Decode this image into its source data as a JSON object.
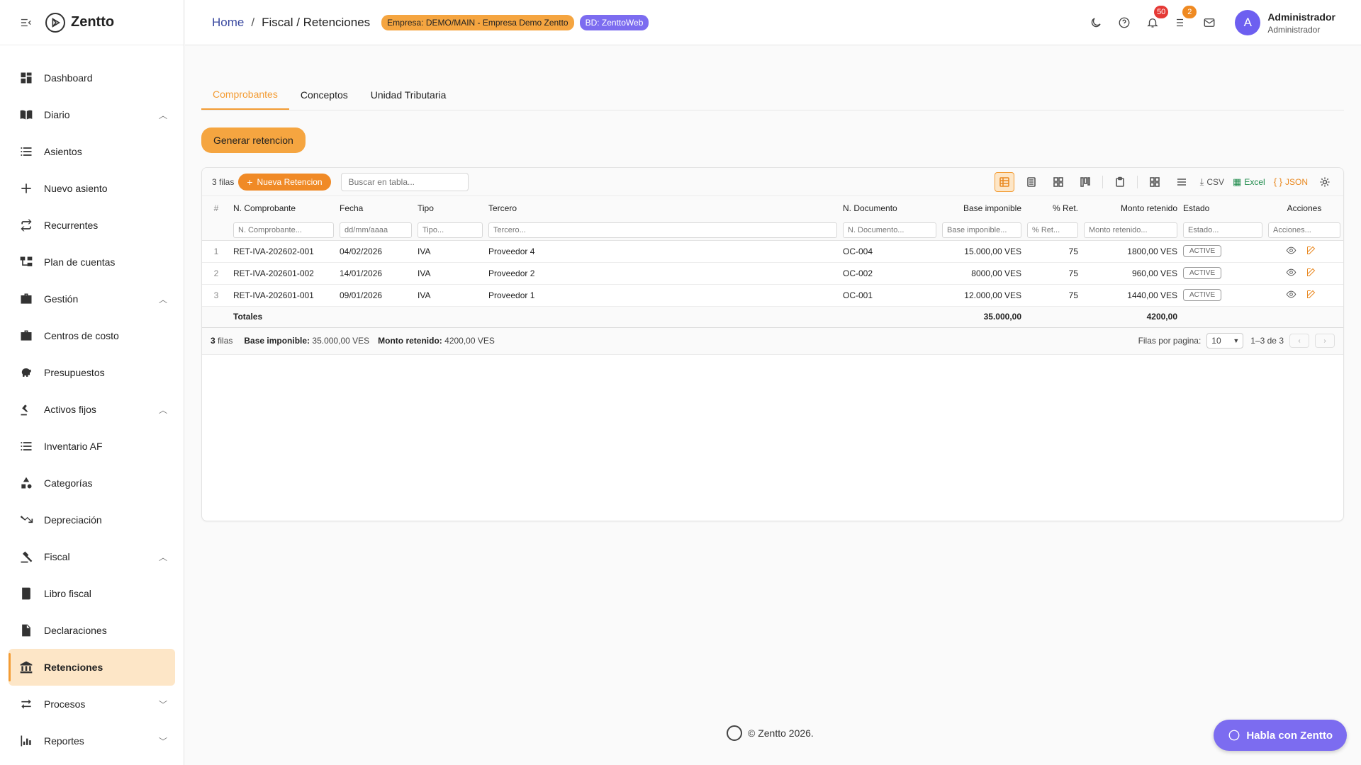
{
  "app": {
    "brand": "Zentto"
  },
  "header": {
    "crumb_home": "Home",
    "crumb_sep": "/",
    "crumb_current": "Fiscal / Retenciones",
    "badge_empresa": "Empresa: DEMO/MAIN - Empresa Demo Zentto",
    "badge_db": "BD: ZenttoWeb",
    "notif_count": "50",
    "tasks_count": "2",
    "user_initial": "A",
    "user_name": "Administrador",
    "user_role": "Administrador"
  },
  "sidebar": {
    "items": [
      {
        "label": "Dashboard",
        "icon": "dashboard-icon",
        "chevron": ""
      },
      {
        "label": "Diario",
        "icon": "book-icon",
        "chevron": "up"
      },
      {
        "label": "Asientos",
        "icon": "list-icon",
        "chevron": ""
      },
      {
        "label": "Nuevo asiento",
        "icon": "plus-icon",
        "chevron": ""
      },
      {
        "label": "Recurrentes",
        "icon": "repeat-icon",
        "chevron": ""
      },
      {
        "label": "Plan de cuentas",
        "icon": "account-tree-icon",
        "chevron": ""
      },
      {
        "label": "Gestión",
        "icon": "briefcase-icon",
        "chevron": "up"
      },
      {
        "label": "Centros de costo",
        "icon": "briefcase-icon",
        "chevron": ""
      },
      {
        "label": "Presupuestos",
        "icon": "piggy-bank-icon",
        "chevron": ""
      },
      {
        "label": "Activos fijos",
        "icon": "precision-icon",
        "chevron": "up"
      },
      {
        "label": "Inventario AF",
        "icon": "list-icon",
        "chevron": ""
      },
      {
        "label": "Categorías",
        "icon": "category-icon",
        "chevron": ""
      },
      {
        "label": "Depreciación",
        "icon": "trending-down-icon",
        "chevron": ""
      },
      {
        "label": "Fiscal",
        "icon": "gavel-icon",
        "chevron": "up"
      },
      {
        "label": "Libro fiscal",
        "icon": "ledger-icon",
        "chevron": ""
      },
      {
        "label": "Declaraciones",
        "icon": "document-icon",
        "chevron": ""
      },
      {
        "label": "Retenciones",
        "icon": "bank-icon",
        "chevron": "",
        "active": true
      },
      {
        "label": "Procesos",
        "icon": "swap-icon",
        "chevron": "down"
      },
      {
        "label": "Reportes",
        "icon": "chart-icon",
        "chevron": "down"
      }
    ]
  },
  "tabs": [
    "Comprobantes",
    "Conceptos",
    "Unidad Tributaria"
  ],
  "generate_button": "Generar retencion",
  "grid": {
    "row_count_label": "3 filas",
    "new_button": "Nueva Retencion",
    "search_placeholder": "Buscar en tabla...",
    "csv_label": "CSV",
    "excel_label": "Excel",
    "json_label": "JSON",
    "columns": [
      "#",
      "N. Comprobante",
      "Fecha",
      "Tipo",
      "Tercero",
      "N. Documento",
      "Base imponible",
      "% Ret.",
      "Monto retenido",
      "Estado",
      "Acciones"
    ],
    "filters": [
      "N. Comprobante...",
      "dd/mm/aaaa",
      "Tipo...",
      "Tercero...",
      "N. Documento...",
      "Base imponible...",
      "% Ret...",
      "Monto retenido...",
      "Estado...",
      "Acciones..."
    ],
    "rows": [
      {
        "idx": "1",
        "comprobante": "RET-IVA-202602-001",
        "fecha": "04/02/2026",
        "tipo": "IVA",
        "tercero": "Proveedor 4",
        "documento": "OC-004",
        "base": "15.000,00 VES",
        "ret": "75",
        "monto": "1800,00 VES",
        "estado": "ACTIVE"
      },
      {
        "idx": "2",
        "comprobante": "RET-IVA-202601-002",
        "fecha": "14/01/2026",
        "tipo": "IVA",
        "tercero": "Proveedor 2",
        "documento": "OC-002",
        "base": "8000,00 VES",
        "ret": "75",
        "monto": "960,00 VES",
        "estado": "ACTIVE"
      },
      {
        "idx": "3",
        "comprobante": "RET-IVA-202601-001",
        "fecha": "09/01/2026",
        "tipo": "IVA",
        "tercero": "Proveedor 1",
        "documento": "OC-001",
        "base": "12.000,00 VES",
        "ret": "75",
        "monto": "1440,00 VES",
        "estado": "ACTIVE"
      }
    ],
    "totals": {
      "label": "Totales",
      "base": "35.000,00",
      "monto": "4200,00"
    },
    "footer": {
      "rows_bold": "3",
      "rows_text": "filas",
      "base_label": "Base imponible:",
      "base_value": "35.000,00 VES",
      "monto_label": "Monto retenido:",
      "monto_value": "4200,00 VES",
      "per_page_label": "Filas por pagina:",
      "per_page_value": "10",
      "range": "1–3 de 3"
    }
  },
  "copyright": "© Zentto 2026.",
  "chat_button": "Habla con Zentto",
  "colors": {
    "accent": "#f39c34",
    "accent_light": "#fde6c7",
    "purple": "#7c6cf0"
  }
}
